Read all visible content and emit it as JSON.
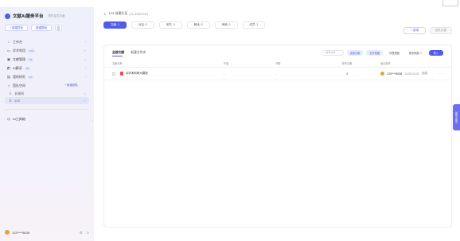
{
  "colors": {
    "accent": "#4f5de8",
    "sidebar_bg": "#eef0fb",
    "float_tab": "#6b6ff0"
  },
  "brand": {
    "title": "文献AI服务平台",
    "cert": "学位论文平台"
  },
  "actions": {
    "new_project": "+ 新建项目",
    "new_group": "新建群组",
    "icon": "copy-icon"
  },
  "nav": [
    {
      "icon": "⌂",
      "label": "工作台",
      "badge": "",
      "right": "›"
    },
    {
      "icon": "▭",
      "label": "学术利用",
      "badge": "100",
      "right": "‹ ›"
    },
    {
      "icon": "▣",
      "label": "文献管理",
      "badge": "99",
      "right": "‹ ›"
    },
    {
      "icon": "◩",
      "label": "AI解读",
      "badge": "99",
      "right": "›"
    },
    {
      "icon": "▤",
      "label": "我的研究",
      "badge": "27",
      "right": "›"
    }
  ],
  "team": {
    "label": "团队空间",
    "add": "+ 新建团队",
    "items": [
      {
        "label": "长城网",
        "right": "‹ ›"
      },
      {
        "label": "123",
        "right": "‹ ›"
      }
    ]
  },
  "ai_tools": {
    "label": "AI工具箱"
  },
  "user": {
    "name": "133****5638",
    "tools": [
      "⚙",
      "⊙"
    ]
  },
  "breadcrumb": {
    "title": "123 创建队伍",
    "id": "(11-4560705)"
  },
  "status_tabs": [
    {
      "label": "文献: 1",
      "active": true
    },
    {
      "label": "对话: 0",
      "active": false
    },
    {
      "label": "研究: 0",
      "active": false
    },
    {
      "label": "解读: 0",
      "active": false
    },
    {
      "label": "审稿: 0",
      "active": false
    },
    {
      "label": "成员: 1",
      "active": false
    }
  ],
  "top_right": {
    "members": "+ 邀请",
    "settings": "团队设置"
  },
  "panel": {
    "tabs": [
      "全部文献",
      "新建文件夹"
    ],
    "search_placeholder": "搜索文献",
    "chips": [
      "设置文献",
      "文件视图",
      "列表视图",
      "更多视图 ∨"
    ],
    "import": "导入"
  },
  "table": {
    "headers": [
      "文献名称",
      "作者",
      "刊物",
      "参考文献",
      "最近操作"
    ],
    "rows": [
      {
        "name": "AI学术科研大模型",
        "author": "-",
        "journal": "-",
        "count": "3",
        "op_user": "133****5638",
        "op_time": "10-08 16:21",
        "op_action": "创建"
      }
    ]
  },
  "float_tab": "反馈与建议"
}
